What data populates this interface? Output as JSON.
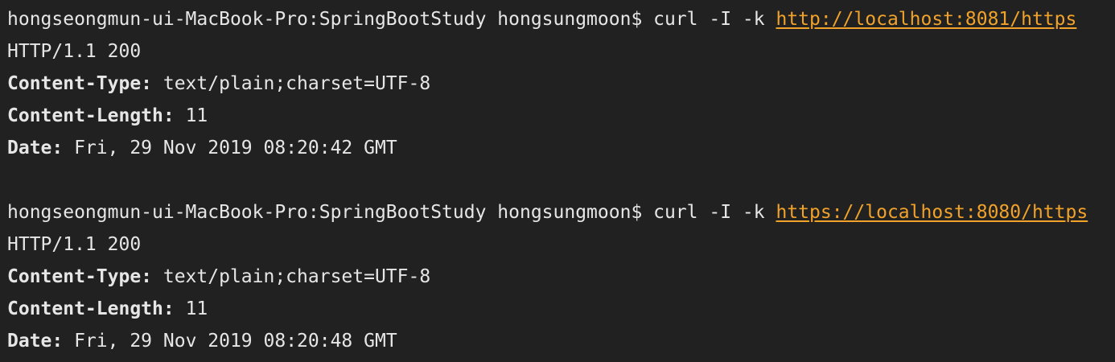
{
  "colors": {
    "background": "#212121",
    "text": "#e6e6e6",
    "link": "#f0a22a"
  },
  "blocks": [
    {
      "prompt": "hongseongmun-ui-MacBook-Pro:SpringBootStudy hongsungmoon$ ",
      "command": "curl -I -k ",
      "url": "http://localhost:8081/https",
      "status": "HTTP/1.1 200",
      "headers": [
        {
          "key": "Content-Type:",
          "value": " text/plain;charset=UTF-8"
        },
        {
          "key": "Content-Length:",
          "value": " 11"
        },
        {
          "key": "Date:",
          "value": " Fri, 29 Nov 2019 08:20:42 GMT"
        }
      ]
    },
    {
      "prompt": "hongseongmun-ui-MacBook-Pro:SpringBootStudy hongsungmoon$ ",
      "command": "curl -I -k ",
      "url": "https://localhost:8080/https",
      "status": "HTTP/1.1 200",
      "headers": [
        {
          "key": "Content-Type:",
          "value": " text/plain;charset=UTF-8"
        },
        {
          "key": "Content-Length:",
          "value": " 11"
        },
        {
          "key": "Date:",
          "value": " Fri, 29 Nov 2019 08:20:48 GMT"
        }
      ]
    }
  ]
}
